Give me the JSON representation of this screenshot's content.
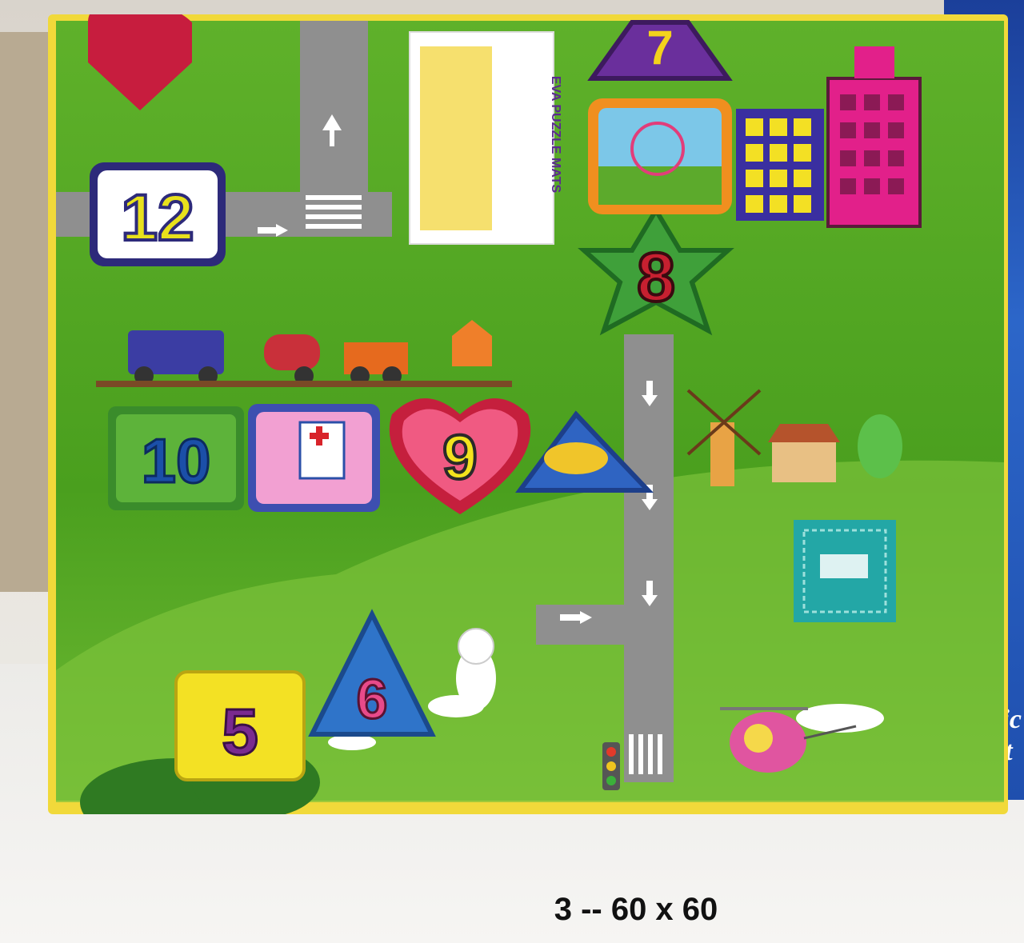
{
  "caption": "3  --   60 x  60",
  "mat_numbers": {
    "n12": "12",
    "n10": "10",
    "n9": "9",
    "n8": "8",
    "n7": "7",
    "n6": "6",
    "n5": "5"
  },
  "label_card": {
    "title": "EVA PUZZLE MATS"
  },
  "right_box": {
    "text_music": "Music",
    "text_light": "Light"
  },
  "colors": {
    "grass": "#4fa61e",
    "grass_light": "#7cc23a",
    "road": "#8e8e8e",
    "foam_edge": "#f0d728",
    "watermark": "#23a7a6"
  }
}
